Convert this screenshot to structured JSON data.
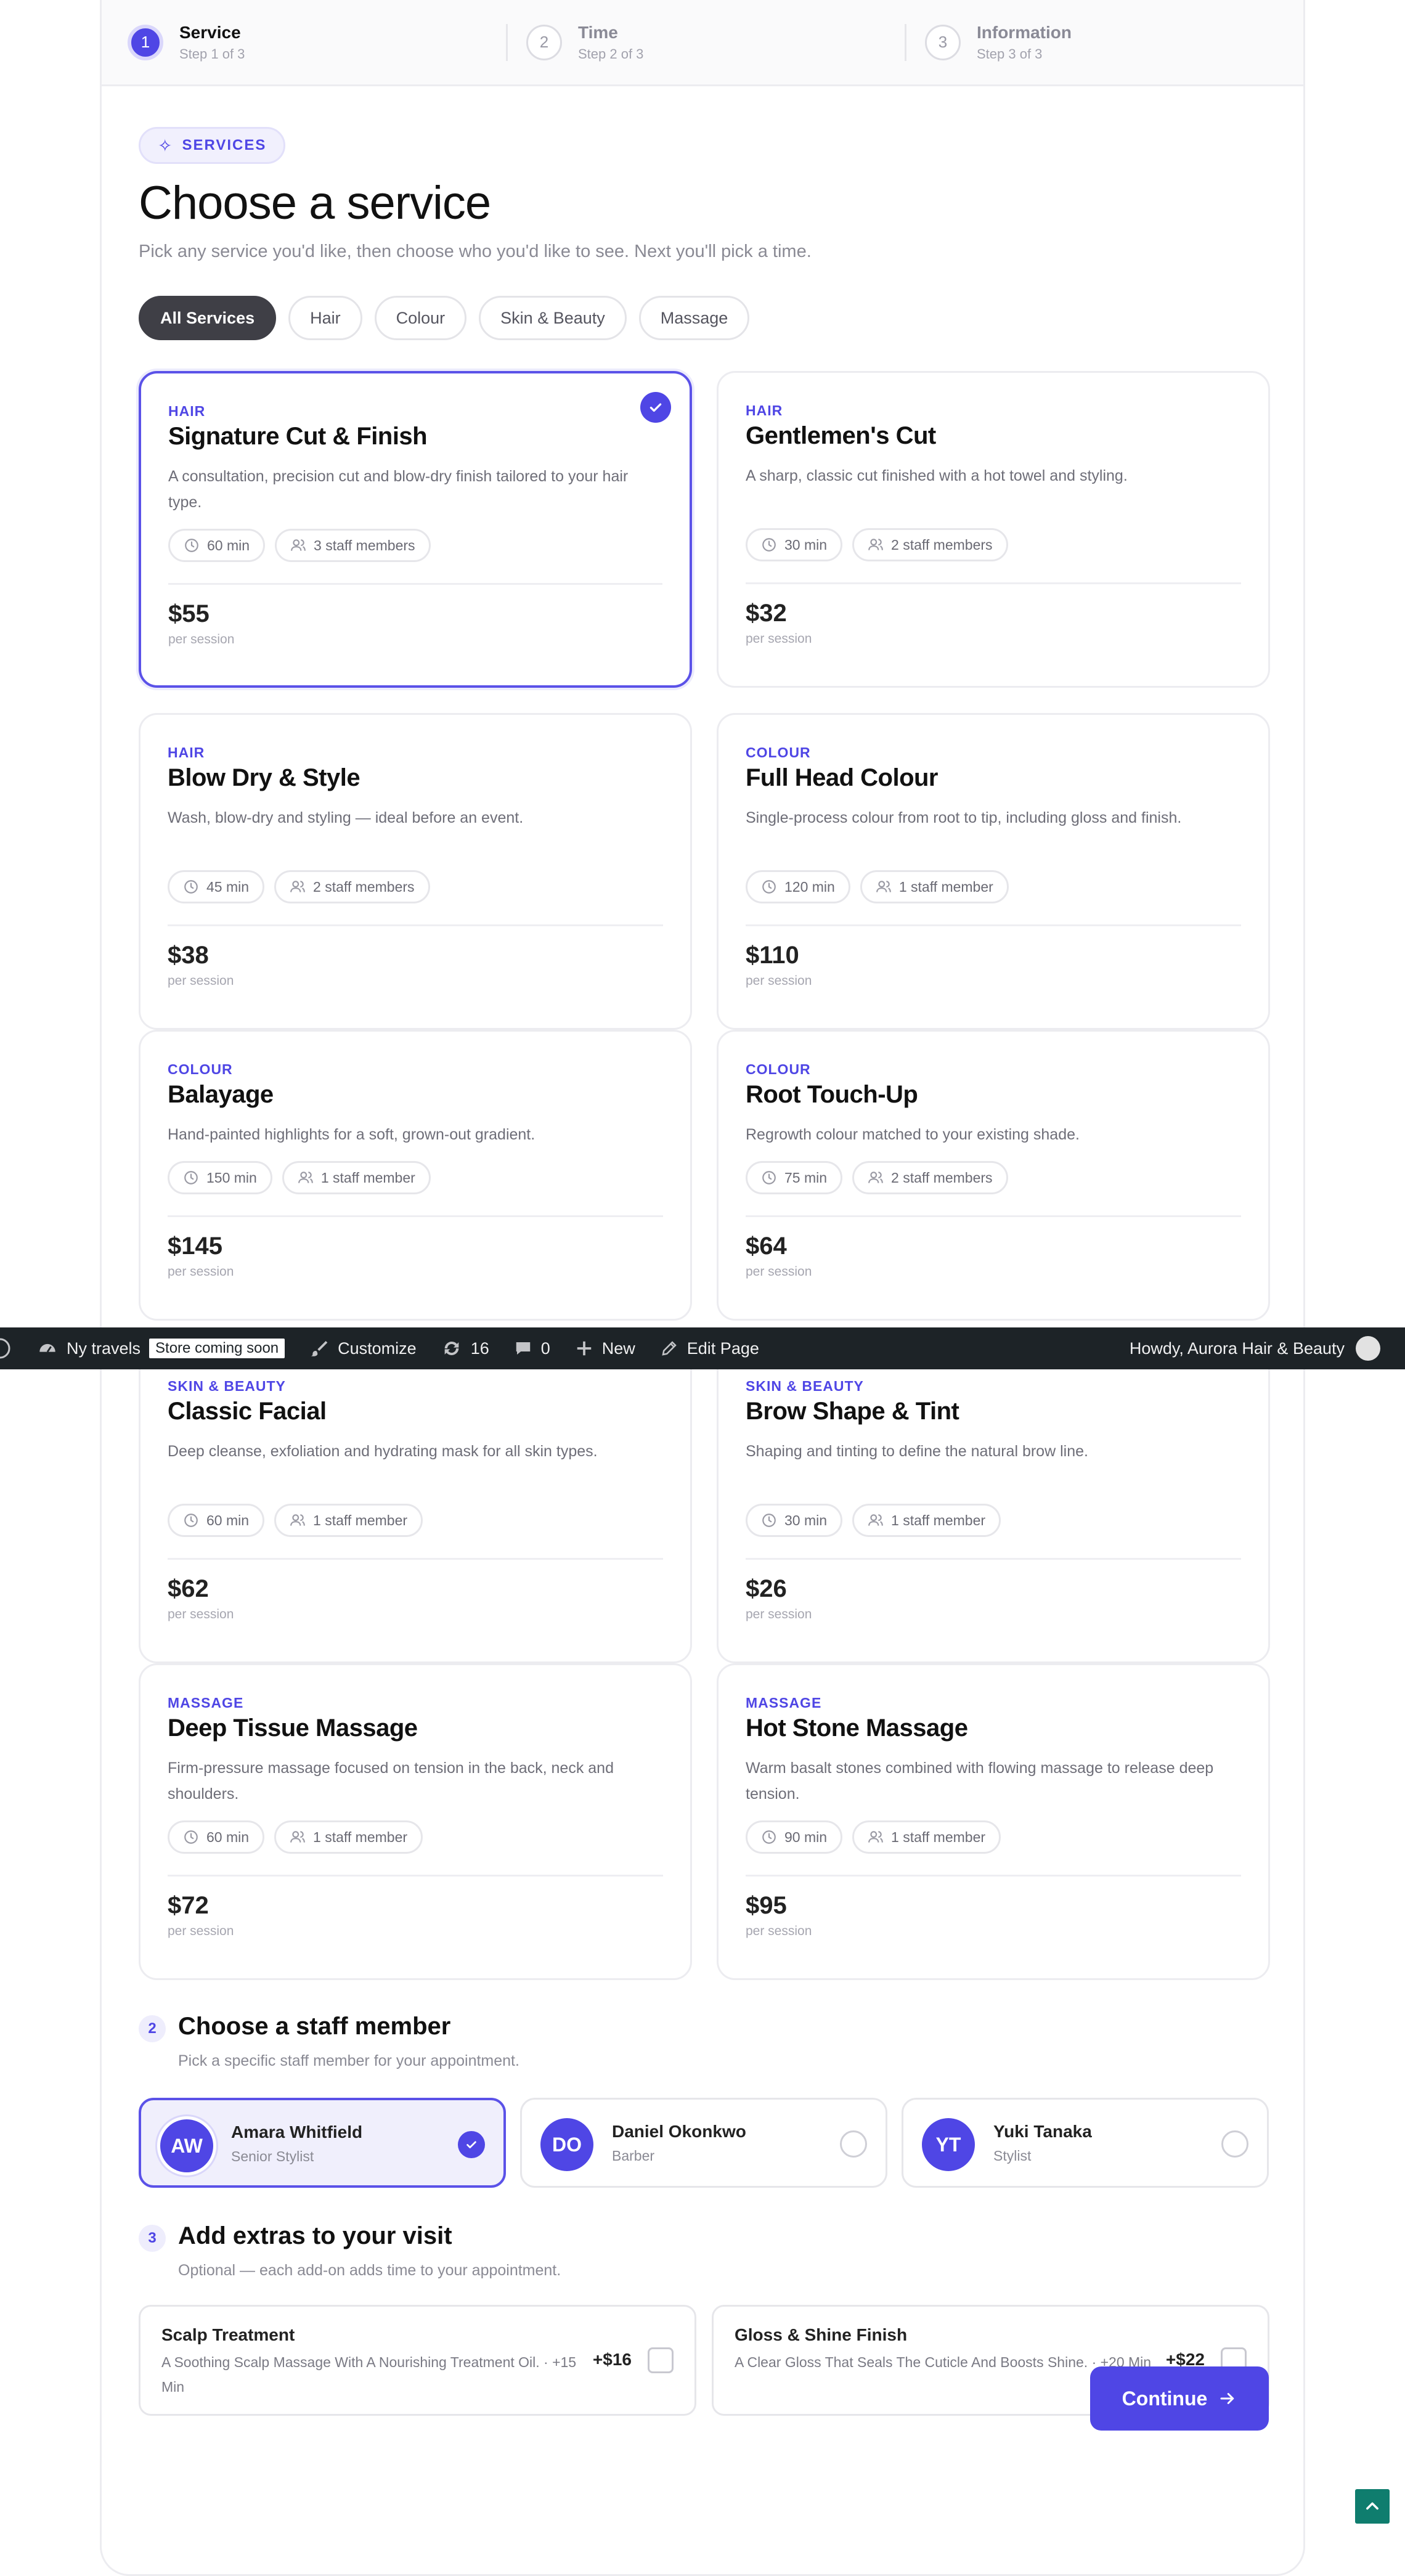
{
  "stepper": [
    {
      "num": "1",
      "title": "Service",
      "sub": "Step 1 of 3"
    },
    {
      "num": "2",
      "title": "Time",
      "sub": "Step 2 of 3"
    },
    {
      "num": "3",
      "title": "Information",
      "sub": "Step 3 of 3"
    }
  ],
  "header": {
    "badge": "SERVICES",
    "title": "Choose a service",
    "subtitle": "Pick any service you'd like, then choose who you'd like to see. Next you'll pick a time."
  },
  "filters": [
    "All Services",
    "Hair",
    "Colour",
    "Skin & Beauty",
    "Massage"
  ],
  "price_suffix": "per session",
  "services": [
    {
      "cat": "HAIR",
      "name": "Signature Cut & Finish",
      "desc": "A consultation, precision cut and blow-dry finish tailored to your hair type.",
      "duration": "60 min",
      "staff": "3 staff members",
      "price": "$55"
    },
    {
      "cat": "HAIR",
      "name": "Gentlemen's Cut",
      "desc": "A sharp, classic cut finished with a hot towel and styling.",
      "duration": "30 min",
      "staff": "2 staff members",
      "price": "$32"
    },
    {
      "cat": "HAIR",
      "name": "Blow Dry & Style",
      "desc": "Wash, blow-dry and styling — ideal before an event.",
      "duration": "45 min",
      "staff": "2 staff members",
      "price": "$38"
    },
    {
      "cat": "COLOUR",
      "name": "Full Head Colour",
      "desc": "Single-process colour from root to tip, including gloss and finish.",
      "duration": "120 min",
      "staff": "1 staff member",
      "price": "$110"
    },
    {
      "cat": "COLOUR",
      "name": "Balayage",
      "desc": "Hand-painted highlights for a soft, grown-out gradient.",
      "duration": "150 min",
      "staff": "1 staff member",
      "price": "$145"
    },
    {
      "cat": "COLOUR",
      "name": "Root Touch-Up",
      "desc": "Regrowth colour matched to your existing shade.",
      "duration": "75 min",
      "staff": "2 staff members",
      "price": "$64"
    },
    {
      "cat": "SKIN & BEAUTY",
      "name": "Classic Facial",
      "desc": "Deep cleanse, exfoliation and hydrating mask for all skin types.",
      "duration": "60 min",
      "staff": "1 staff member",
      "price": "$62"
    },
    {
      "cat": "SKIN & BEAUTY",
      "name": "Brow Shape & Tint",
      "desc": "Shaping and tinting to define the natural brow line.",
      "duration": "30 min",
      "staff": "1 staff member",
      "price": "$26"
    },
    {
      "cat": "MASSAGE",
      "name": "Deep Tissue Massage",
      "desc": "Firm-pressure massage focused on tension in the back, neck and shoulders.",
      "duration": "60 min",
      "staff": "1 staff member",
      "price": "$72"
    },
    {
      "cat": "MASSAGE",
      "name": "Hot Stone Massage",
      "desc": "Warm basalt stones combined with flowing massage to release deep tension.",
      "duration": "90 min",
      "staff": "1 staff member",
      "price": "$95"
    }
  ],
  "adminbar": {
    "site": "Ny travels",
    "badge": "Store coming soon",
    "customize": "Customize",
    "updates": "16",
    "comments": "0",
    "new": "New",
    "edit": "Edit Page",
    "howdy": "Howdy, Aurora Hair & Beauty"
  },
  "staff_section": {
    "num": "2",
    "title": "Choose a staff member",
    "subtitle": "Pick a specific staff member for your appointment."
  },
  "staff": [
    {
      "initials": "AW",
      "name": "Amara Whitfield",
      "role": "Senior Stylist"
    },
    {
      "initials": "DO",
      "name": "Daniel Okonkwo",
      "role": "Barber"
    },
    {
      "initials": "YT",
      "name": "Yuki Tanaka",
      "role": "Stylist"
    }
  ],
  "extras_section": {
    "num": "3",
    "title": "Add extras to your visit",
    "subtitle": "Optional — each add-on adds time to your appointment."
  },
  "extras": [
    {
      "name": "Scalp Treatment",
      "desc": "A Soothing Scalp Massage With A Nourishing Treatment Oil. · +15 Min",
      "price": "+$16"
    },
    {
      "name": "Gloss & Shine Finish",
      "desc": "A Clear Gloss That Seals The Cuticle And Boosts Shine. · +20 Min",
      "price": "+$22"
    }
  ],
  "continue_label": "Continue",
  "colors": {
    "accent": "#4f46e5",
    "adminbar": "#1d2327",
    "to_top": "#0f7d6e"
  }
}
